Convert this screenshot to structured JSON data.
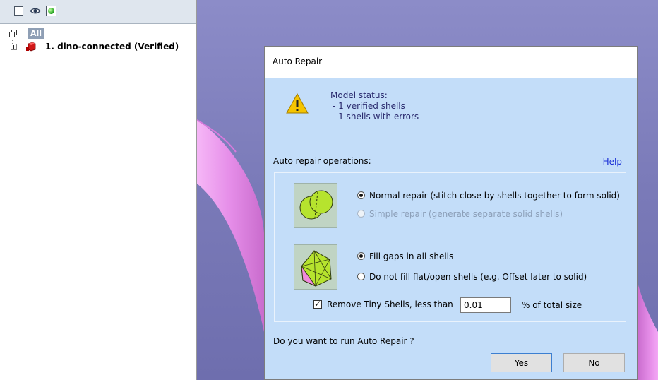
{
  "tree": {
    "toolbar": {
      "collapse_icon": "collapse-icon",
      "eye_icon": "eye-icon",
      "color_icon": "color-ball-icon"
    },
    "root_label": "All",
    "part_label": "1. dino-connected (Verified)"
  },
  "dialog": {
    "title": "Auto Repair",
    "status": {
      "heading": "Model status:",
      "line1": "- 1 verified shells",
      "line2": "- 1 shells with errors"
    },
    "ops_label": "Auto repair operations:",
    "help": "Help",
    "repair_options": {
      "normal": "Normal repair (stitch close by shells together to form solid)",
      "simple": "Simple repair (generate separate solid shells)"
    },
    "fill_options": {
      "fill_all": "Fill gaps in all shells",
      "no_fill": "Do not fill flat/open shells (e.g. Offset later to solid)"
    },
    "tiny_shells": {
      "label": "Remove Tiny Shells, less than",
      "value": "0.01",
      "unit": "% of total size",
      "checked": true
    },
    "question": "Do you want to run Auto Repair ?",
    "yes": "Yes",
    "no": "No"
  },
  "colors": {
    "dialog_bg": "#c3ddf9",
    "viewport_bg": "#7f7fc0",
    "model_pink": "#e58de8",
    "help_link": "#1a2fd6"
  }
}
